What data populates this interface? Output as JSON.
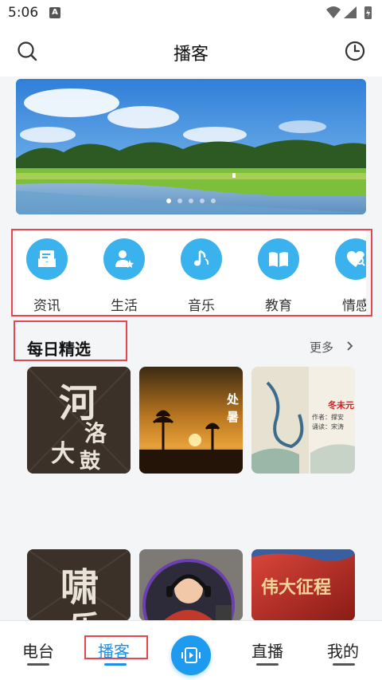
{
  "status": {
    "time": "5:06",
    "notification_badge": "A"
  },
  "header": {
    "title": "播客",
    "search_icon": "search-icon",
    "history_icon": "clock-icon"
  },
  "banner": {
    "slide_count": 5,
    "active_slide": 1
  },
  "categories": [
    {
      "label": "资讯",
      "icon": "news-icon"
    },
    {
      "label": "生活",
      "icon": "person-star-icon"
    },
    {
      "label": "音乐",
      "icon": "music-note-icon"
    },
    {
      "label": "教育",
      "icon": "book-icon"
    },
    {
      "label": "情感",
      "icon": "heart-search-icon"
    }
  ],
  "section": {
    "title": "每日精选",
    "more_label": "更多"
  },
  "albums": [
    {
      "art_text": [
        "河",
        "洛",
        "大",
        "鼓"
      ]
    },
    {
      "art_text": [
        "处",
        "暑"
      ]
    },
    {
      "art_text": [
        "作者：撑安",
        "诵读：宋涛",
        "冬未元"
      ]
    },
    {
      "art_text": [
        "啸",
        "乐"
      ]
    },
    {
      "art_text": []
    },
    {
      "art_text": [
        "伟大征程"
      ]
    }
  ],
  "bottom_nav": {
    "items": [
      {
        "label": "电台"
      },
      {
        "label": "播客"
      },
      {
        "label": "直播"
      },
      {
        "label": "我的"
      }
    ],
    "active_index": 1,
    "center_icon": "play-video-icon"
  },
  "colors": {
    "accent": "#1e8fe6",
    "category_icon_bg": "#3ab2ee",
    "highlight": "#e8464f"
  }
}
